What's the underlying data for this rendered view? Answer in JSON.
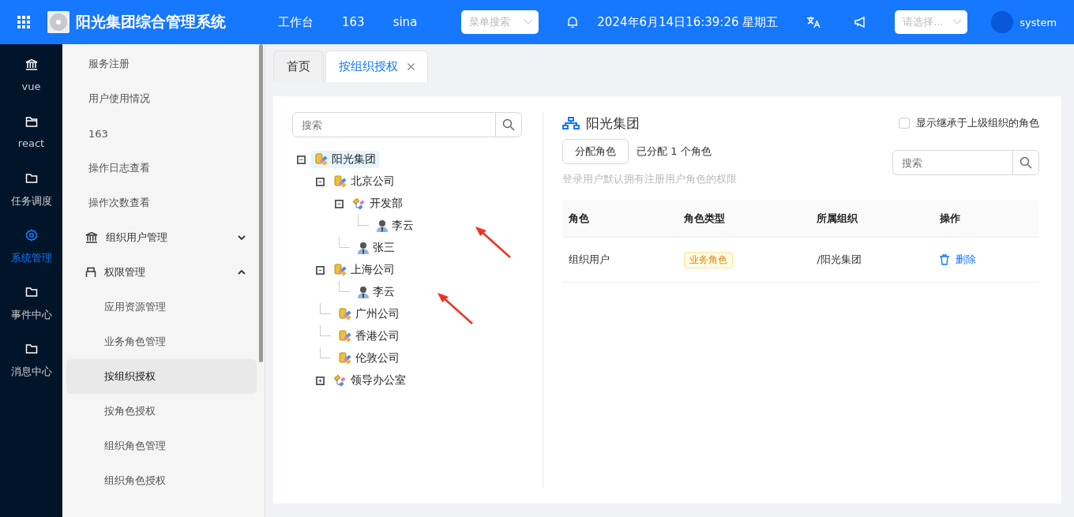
{
  "header": {
    "title": "阳光集团综合管理系统",
    "nav": [
      "工作台",
      "163",
      "sina"
    ],
    "menu_search": {
      "placeholder": "菜单搜索"
    },
    "datetime": "2024年6月14日16:39:26 星期五",
    "select": {
      "placeholder": "请选择..."
    },
    "user": "system"
  },
  "rail": [
    {
      "label": "vue",
      "kind": "bank",
      "selected": false
    },
    {
      "label": "react",
      "kind": "tray",
      "selected": false
    },
    {
      "label": "任务调度",
      "kind": "folder",
      "selected": false
    },
    {
      "label": "系统管理",
      "kind": "gear",
      "selected": true
    },
    {
      "label": "事件中心",
      "kind": "folder",
      "selected": false
    },
    {
      "label": "消息中心",
      "kind": "folder",
      "selected": false
    }
  ],
  "menu": [
    {
      "kind": "item",
      "label": "服务注册"
    },
    {
      "kind": "item",
      "label": "用户使用情况"
    },
    {
      "kind": "item",
      "label": "163"
    },
    {
      "kind": "item",
      "label": "操作日志查看"
    },
    {
      "kind": "item",
      "label": "操作次数查看"
    },
    {
      "kind": "group",
      "label": "组织用户管理",
      "expanded": false
    },
    {
      "kind": "group",
      "label": "权限管理",
      "expanded": true
    },
    {
      "kind": "sub",
      "label": "应用资源管理",
      "selected": false
    },
    {
      "kind": "sub",
      "label": "业务角色管理",
      "selected": false
    },
    {
      "kind": "sub",
      "label": "按组织授权",
      "selected": true
    },
    {
      "kind": "sub",
      "label": "按角色授权",
      "selected": false
    },
    {
      "kind": "sub",
      "label": "组织角色管理",
      "selected": false
    },
    {
      "kind": "sub",
      "label": "组织角色授权",
      "selected": false
    }
  ],
  "tabs": [
    {
      "label": "首页",
      "selected": false,
      "closable": false
    },
    {
      "label": "按组织授权",
      "selected": true,
      "closable": true
    }
  ],
  "tree_search": {
    "placeholder": "搜索"
  },
  "tree": [
    {
      "kind": "company",
      "label": "阳光集团",
      "selected": true,
      "expanded": true,
      "children": [
        {
          "kind": "company",
          "label": "北京公司",
          "selected": false,
          "expanded": true,
          "children": [
            {
              "kind": "department",
              "label": "开发部",
              "selected": false,
              "expanded": true,
              "children": [
                {
                  "kind": "person",
                  "label": "李云",
                  "selected": false,
                  "marked": true
                }
              ]
            },
            {
              "kind": "person",
              "label": "张三",
              "selected": false,
              "marked": false
            }
          ]
        },
        {
          "kind": "company",
          "label": "上海公司",
          "selected": false,
          "expanded": true,
          "children": [
            {
              "kind": "person",
              "label": "李云",
              "selected": false,
              "marked": true
            }
          ]
        },
        {
          "kind": "company",
          "label": "广州公司",
          "selected": false
        },
        {
          "kind": "company",
          "label": "香港公司",
          "selected": false
        },
        {
          "kind": "company",
          "label": "伦敦公司",
          "selected": false
        },
        {
          "kind": "department",
          "label": "领导办公室",
          "selected": false,
          "expanded": false
        }
      ]
    }
  ],
  "detail": {
    "title": "阳光集团",
    "inherit": {
      "label": "显示继承于上级组织的角色",
      "checked": false
    },
    "assign_button": "分配角色",
    "assigned": "已分配 1 个角色",
    "hint": "登录用户默认拥有注册用户角色的权限",
    "search": {
      "placeholder": "搜索"
    },
    "table": {
      "columns": [
        "角色",
        "角色类型",
        "所属组织",
        "操作"
      ],
      "rows": [
        {
          "role": "组织用户",
          "type": "业务角色",
          "org": "/阳光集团",
          "action": "删除"
        }
      ]
    }
  }
}
